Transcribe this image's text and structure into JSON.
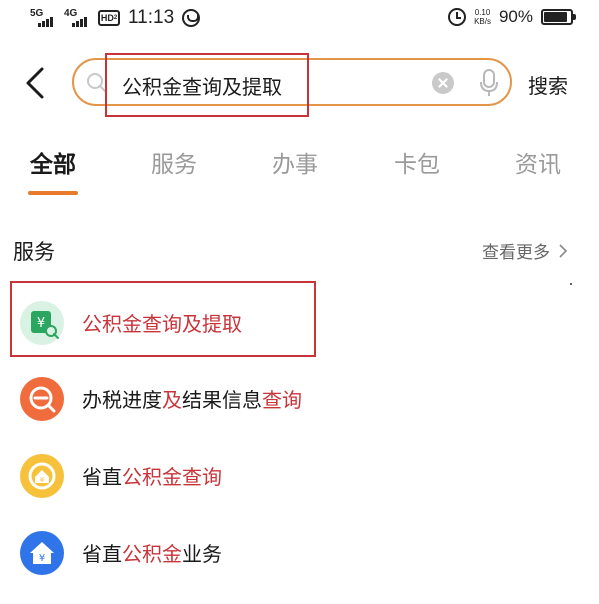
{
  "status_bar": {
    "signal1_gen": "5G",
    "signal2_gen": "4G",
    "hd_label": "HD",
    "hd_sub": "2",
    "time": "11:13",
    "speed_value": "0.10",
    "speed_unit": "KB/s",
    "battery": "90%"
  },
  "search": {
    "query": "公积金查询及提取",
    "button_label": "搜索"
  },
  "tabs": [
    {
      "label": "全部",
      "active": true
    },
    {
      "label": "服务",
      "active": false
    },
    {
      "label": "办事",
      "active": false
    },
    {
      "label": "卡包",
      "active": false
    },
    {
      "label": "资讯",
      "active": false
    }
  ],
  "section": {
    "title": "服务",
    "more_label": "查看更多"
  },
  "results": [
    {
      "icon": "yuan-search-icon",
      "color": "#2aa660",
      "parts": [
        {
          "text": "公积金查询及提取",
          "hl": true
        }
      ]
    },
    {
      "icon": "tax-search-icon",
      "color": "#f06c3c",
      "parts": [
        {
          "text": "办税进度",
          "hl": false
        },
        {
          "text": "及",
          "hl": true
        },
        {
          "text": "结果信息",
          "hl": false
        },
        {
          "text": "查询",
          "hl": true
        }
      ]
    },
    {
      "icon": "gold-house-icon",
      "color": "#f6c23c",
      "parts": [
        {
          "text": "省直",
          "hl": false
        },
        {
          "text": "公积金查询",
          "hl": true
        }
      ]
    },
    {
      "icon": "blue-house-icon",
      "color": "#2f74e8",
      "parts": [
        {
          "text": "省直",
          "hl": false
        },
        {
          "text": "公积金",
          "hl": true
        },
        {
          "text": "业务",
          "hl": false
        }
      ]
    }
  ],
  "colors": {
    "accent_orange": "#e87a2b",
    "highlight_red": "#c8343a",
    "annotation_red": "#c8343a"
  }
}
